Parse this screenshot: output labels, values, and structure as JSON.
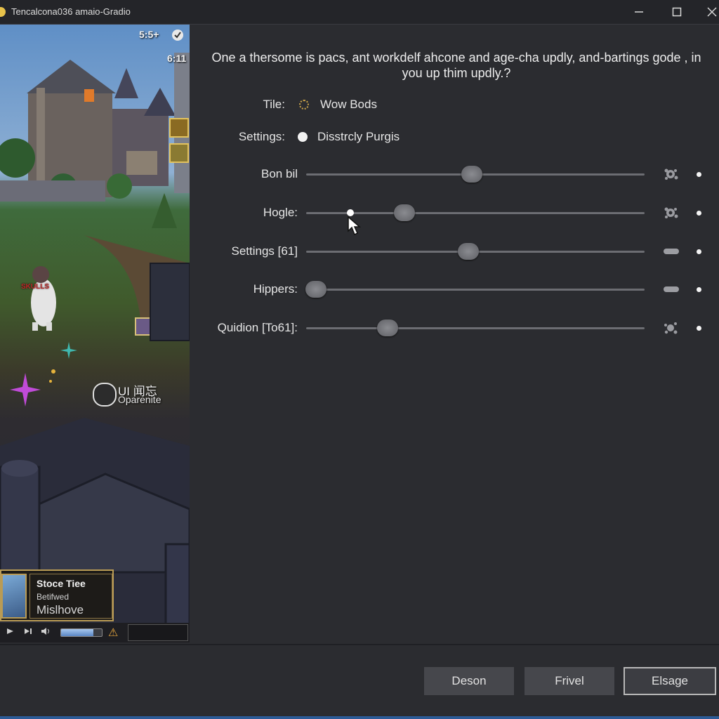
{
  "window": {
    "title": "Tencalcona036 amaio-Gradio",
    "minimize_icon": "minimize-icon",
    "maximize_icon": "maximize-icon",
    "close_icon": "close-icon"
  },
  "game": {
    "hud_top": "5:5+",
    "hud_right": "6:11",
    "character_tag": "SKULLS",
    "notice_title": "UI 闻忘",
    "notice_subtitle": "Oparenite",
    "item_card": {
      "title": "Stoce Tiee",
      "subtitle": "Betifwed",
      "name": "Mislhove"
    },
    "media": {
      "progress": 0.8
    }
  },
  "panel": {
    "question": "One a thersome is pacs, ant workdelf ahcone and age-cha updly, and-bartings gode , in you up thim updly.?",
    "title_field": {
      "label": "Tile:",
      "value": "Wow Bods"
    },
    "settings_field": {
      "label": "Settings:",
      "value": "Disstrcly Purgis"
    },
    "sliders": [
      {
        "label": "Bon bil",
        "value": 0.49,
        "icon": "gear-icon"
      },
      {
        "label": "Hogle:",
        "value": 0.29,
        "marker": 0.13,
        "icon": "gear-icon"
      },
      {
        "label": "Settings [61]",
        "value": 0.48,
        "icon": "pill-icon"
      },
      {
        "label": "Hippers:",
        "value": 0.03,
        "icon": "pill-icon"
      },
      {
        "label": "Quidion [To61]:",
        "value": 0.24,
        "icon": "splat-icon"
      }
    ]
  },
  "footer": {
    "buttons": [
      {
        "label": "Deson"
      },
      {
        "label": "Frivel"
      },
      {
        "label": "Elsage"
      }
    ]
  },
  "colors": {
    "panel_bg": "#2b2c30",
    "title_bar": "#242529",
    "accent_gold": "#b99b55",
    "bottom_edge": "#2c5b97"
  }
}
